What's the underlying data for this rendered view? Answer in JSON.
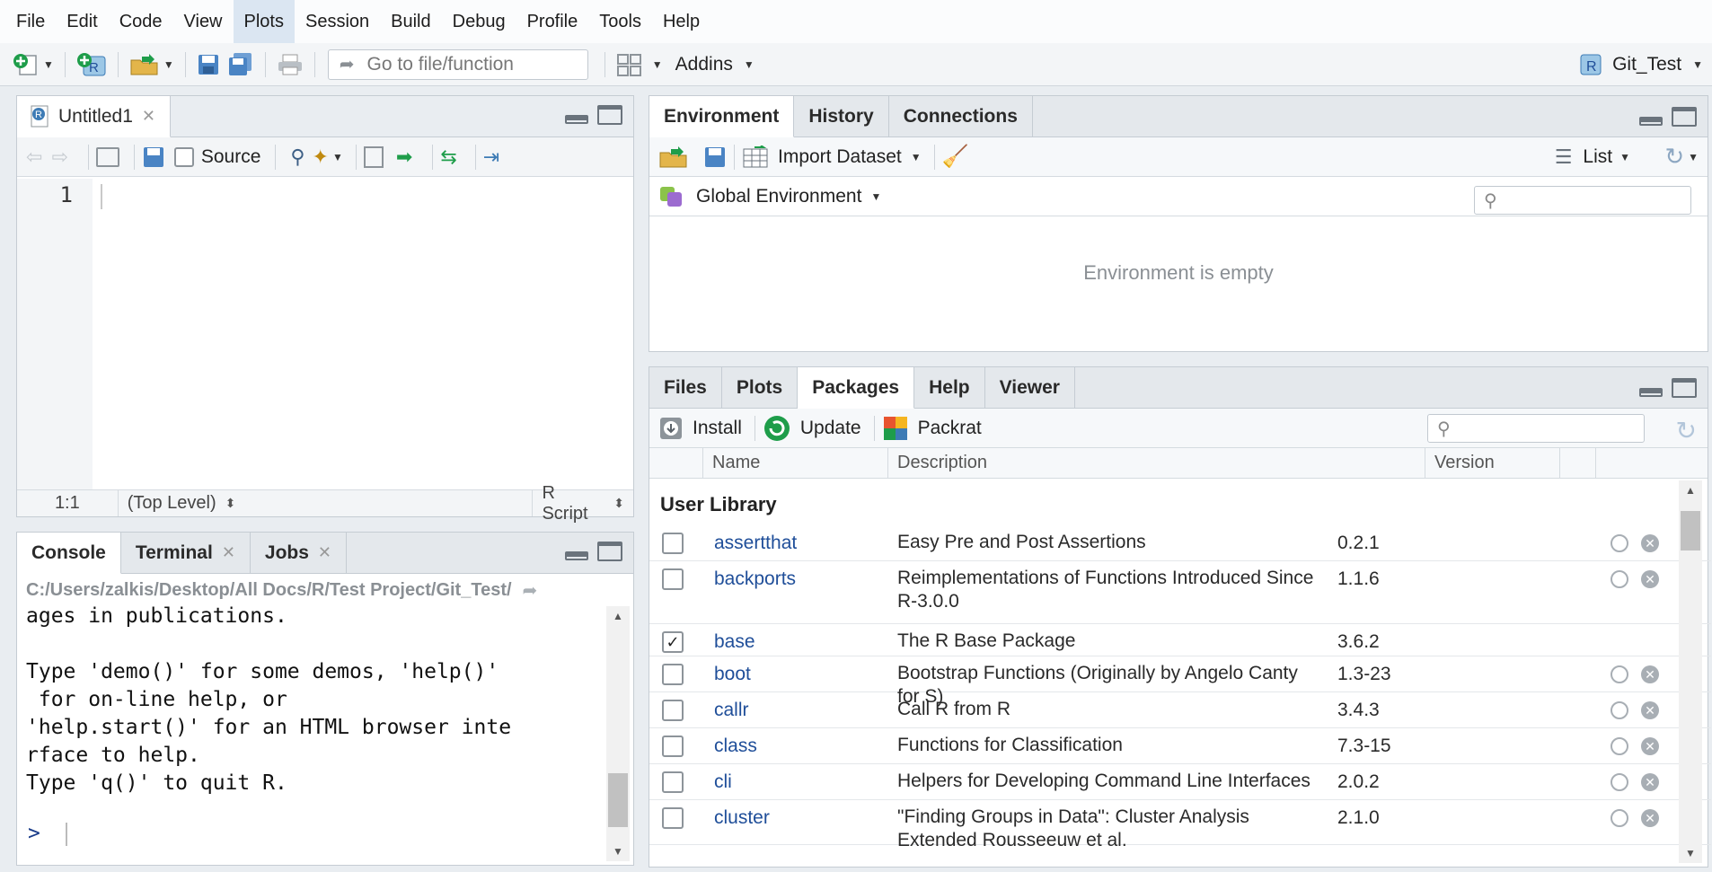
{
  "menubar": {
    "items": [
      "File",
      "Edit",
      "Code",
      "View",
      "Plots",
      "Session",
      "Build",
      "Debug",
      "Profile",
      "Tools",
      "Help"
    ],
    "active": "Plots"
  },
  "toolbar": {
    "goto_placeholder": "Go to file/function",
    "addins_label": "Addins",
    "project_name": "Git_Test"
  },
  "editor": {
    "tab_title": "Untitled1",
    "source_label": "Source",
    "line_numbers": [
      "1"
    ],
    "status": {
      "position": "1:1",
      "scope": "(Top Level)",
      "file_type": "R Script"
    }
  },
  "console": {
    "tabs": [
      "Console",
      "Terminal",
      "Jobs"
    ],
    "path": "C:/Users/zalkis/Desktop/All Docs/R/Test Project/Git_Test/",
    "output": "ages in publications.\n\nType 'demo()' for some demos, 'help()'\n for on-line help, or\n'help.start()' for an HTML browser inte\nrface to help.\nType 'q()' to quit R.",
    "prompt": ">"
  },
  "environment": {
    "tabs": [
      "Environment",
      "History",
      "Connections"
    ],
    "import_label": "Import Dataset",
    "view_mode": "List",
    "scope_label": "Global Environment",
    "empty_message": "Environment is empty"
  },
  "packages": {
    "tabs": [
      "Files",
      "Plots",
      "Packages",
      "Help",
      "Viewer"
    ],
    "active_tab": "Packages",
    "install_label": "Install",
    "update_label": "Update",
    "packrat_label": "Packrat",
    "columns": [
      "Name",
      "Description",
      "Version"
    ],
    "section_title": "User Library",
    "rows": [
      {
        "name": "assertthat",
        "description": "Easy Pre and Post Assertions",
        "version": "0.2.1",
        "checked": false
      },
      {
        "name": "backports",
        "description": "Reimplementations of Functions Introduced Since R-3.0.0",
        "version": "1.1.6",
        "checked": false
      },
      {
        "name": "base",
        "description": "The R Base Package",
        "version": "3.6.2",
        "checked": true
      },
      {
        "name": "boot",
        "description": "Bootstrap Functions (Originally by Angelo Canty for S)",
        "version": "1.3-23",
        "checked": false
      },
      {
        "name": "callr",
        "description": "Call R from R",
        "version": "3.4.3",
        "checked": false
      },
      {
        "name": "class",
        "description": "Functions for Classification",
        "version": "7.3-15",
        "checked": false
      },
      {
        "name": "cli",
        "description": "Helpers for Developing Command Line Interfaces",
        "version": "2.0.2",
        "checked": false
      },
      {
        "name": "cluster",
        "description": "\"Finding Groups in Data\": Cluster Analysis Extended Rousseeuw et al.",
        "version": "2.1.0",
        "checked": false
      }
    ]
  },
  "colors": {
    "accent_blue": "#1f4e99",
    "pane_header": "#e4e8ec",
    "green_icon": "#1e9d4a"
  }
}
